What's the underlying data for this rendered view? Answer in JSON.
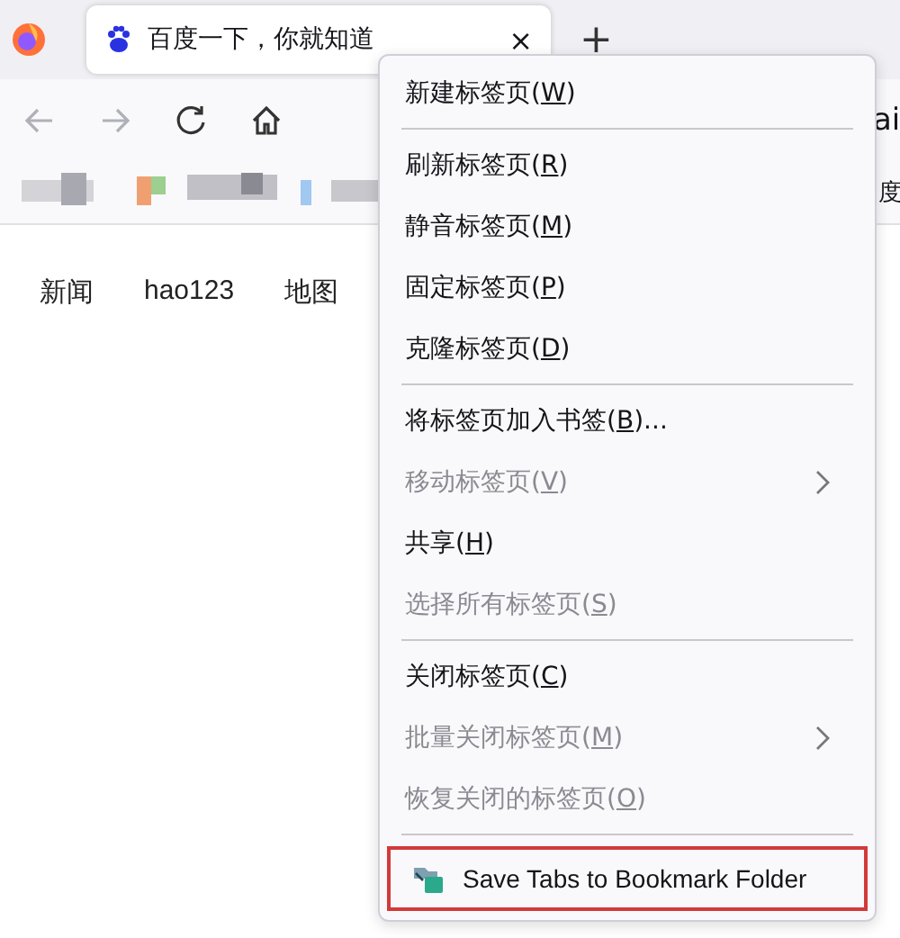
{
  "tab_strip": {
    "tabs": [
      {
        "title": "百度一下，你就知道",
        "close": "×",
        "selected": true
      }
    ],
    "new_tab": "+"
  },
  "page_links": [
    "新闻",
    "hao123",
    "地图"
  ],
  "right_edge_texts": [
    "ai",
    "度"
  ],
  "context_menu": {
    "items": [
      {
        "kind": "item",
        "before": "新建标签页(",
        "key": "W",
        "after": ")",
        "disabled": false,
        "submenu": false
      },
      {
        "kind": "separator"
      },
      {
        "kind": "item",
        "before": "刷新标签页(",
        "key": "R",
        "after": ")",
        "disabled": false,
        "submenu": false
      },
      {
        "kind": "item",
        "before": "静音标签页(",
        "key": "M",
        "after": ")",
        "disabled": false,
        "submenu": false
      },
      {
        "kind": "item",
        "before": "固定标签页(",
        "key": "P",
        "after": ")",
        "disabled": false,
        "submenu": false
      },
      {
        "kind": "item",
        "before": "克隆标签页(",
        "key": "D",
        "after": ")",
        "disabled": false,
        "submenu": false
      },
      {
        "kind": "separator"
      },
      {
        "kind": "item",
        "before": "将标签页加入书签(",
        "key": "B",
        "after": ")...",
        "disabled": false,
        "submenu": false
      },
      {
        "kind": "item",
        "before": "移动标签页(",
        "key": "V",
        "after": ")",
        "disabled": true,
        "submenu": true
      },
      {
        "kind": "item",
        "before": "共享(",
        "key": "H",
        "after": ")",
        "disabled": false,
        "submenu": false
      },
      {
        "kind": "item",
        "before": "选择所有标签页(",
        "key": "S",
        "after": ")",
        "disabled": true,
        "submenu": false
      },
      {
        "kind": "separator"
      },
      {
        "kind": "item",
        "before": "关闭标签页(",
        "key": "C",
        "after": ")",
        "disabled": false,
        "submenu": false
      },
      {
        "kind": "item",
        "before": "批量关闭标签页(",
        "key": "M",
        "after": ")",
        "disabled": true,
        "submenu": true
      },
      {
        "kind": "item",
        "before": "恢复关闭的标签页(",
        "key": "O",
        "after": ")",
        "disabled": true,
        "submenu": false
      },
      {
        "kind": "separator"
      },
      {
        "kind": "extension",
        "label": "Save Tabs to Bookmark Folder",
        "highlighted": true
      }
    ]
  }
}
